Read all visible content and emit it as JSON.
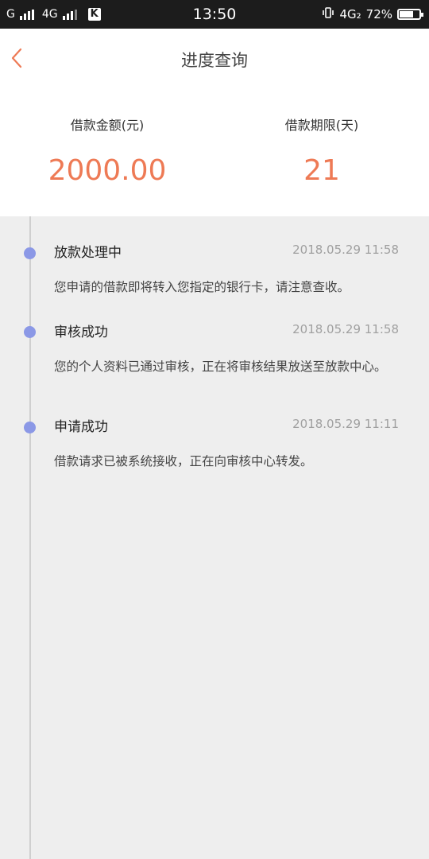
{
  "status_bar": {
    "carrier1": "G",
    "carrier2": "4G",
    "time": "13:50",
    "network_right": "4G₂",
    "battery_text": "72%",
    "battery_level": 0.72
  },
  "header": {
    "title": "进度查询",
    "back_icon": "chevron-left-icon"
  },
  "summary": {
    "amount_label": "借款金额(元)",
    "amount_value": "2000.00",
    "term_label": "借款期限(天)",
    "term_value": "21"
  },
  "timeline": [
    {
      "title": "放款处理中",
      "time": "2018.05.29 11:58",
      "desc": "您申请的借款即将转入您指定的银行卡，请注意查收。"
    },
    {
      "title": "审核成功",
      "time": "2018.05.29 11:58",
      "desc": "您的个人资料已通过审核，正在将审核结果放送至放款中心。"
    },
    {
      "title": "申请成功",
      "time": "2018.05.29 11:11",
      "desc": "借款请求已被系统接收，正在向审核中心转发。"
    }
  ],
  "colors": {
    "accent": "#ee7a55",
    "timeline_dot": "#8b98e6"
  }
}
